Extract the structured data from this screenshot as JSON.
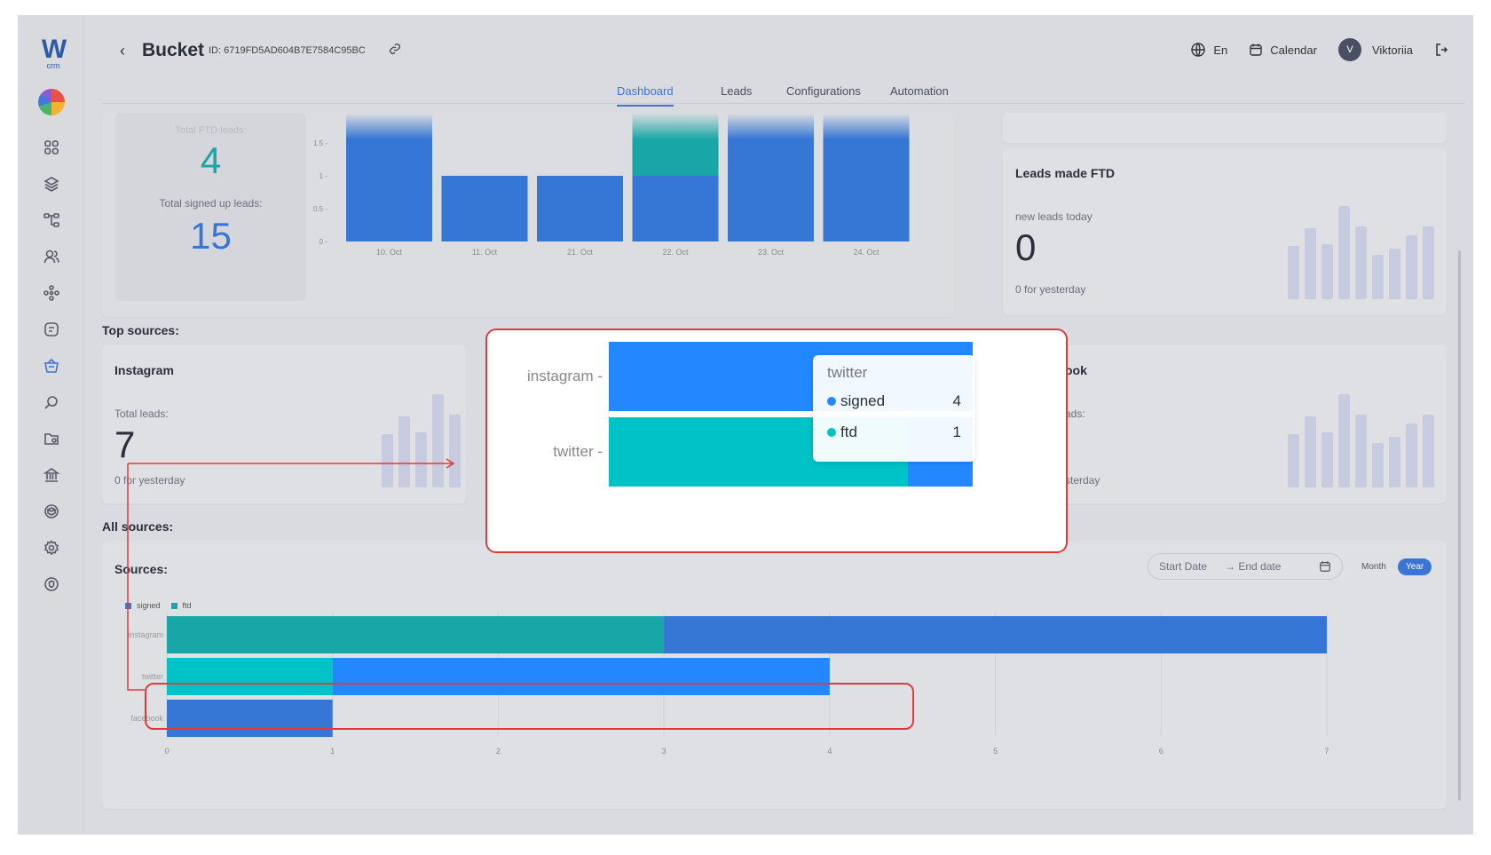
{
  "app": {
    "logo_letter": "W",
    "logo_sub": "crm"
  },
  "header": {
    "back_icon": "chevron-left-icon",
    "title": "Bucket",
    "bucket_id": "ID: 6719FD5AD604B7E7584C95BC",
    "language": "En",
    "calendar": "Calendar",
    "avatar_initial": "V",
    "user_name": "Viktoriia"
  },
  "tabs": [
    {
      "label": "Dashboard",
      "active": true
    },
    {
      "label": "Leads",
      "active": false
    },
    {
      "label": "Configurations",
      "active": false
    },
    {
      "label": "Automation",
      "active": false
    }
  ],
  "ftd_card": {
    "faded_label": "Total FTD leads:",
    "ftd_value": "4",
    "signed_label": "Total signed up leads:",
    "signed_value": "15"
  },
  "daily_chart": {
    "y_ticks": [
      "1.5",
      "1",
      "0.5",
      "0"
    ],
    "x_labels": [
      "10. Oct",
      "11. Oct",
      "21. Oct",
      "22. Oct",
      "23. Oct",
      "24. Oct"
    ]
  },
  "leads_made_ftd": {
    "title": "Leads made FTD",
    "sub_label": "new leads today",
    "value": "0",
    "footer": "0 for yesterday"
  },
  "top_sources": {
    "title": "Top sources:",
    "instagram": {
      "title": "Instagram",
      "label": "Total leads:",
      "value": "7",
      "footer": "0 for yesterday"
    },
    "facebook_partial": {
      "title": "ook",
      "label": "ads:",
      "footer": "sterday"
    }
  },
  "all_sources": {
    "title": "All sources:",
    "card_title": "Sources:",
    "start_date_placeholder": "Start Date",
    "end_date_placeholder": "→ End date",
    "month_label": "Month",
    "year_label": "Year",
    "legend_signed": "signed",
    "legend_ftd": "ftd"
  },
  "colors": {
    "signed": "#3676d4",
    "ftd": "#18a6a6",
    "signed_bright": "#2388ff",
    "ftd_bright": "#00c2c7",
    "accent": "#3b74d6"
  },
  "chart_data": [
    {
      "type": "bar",
      "orientation": "horizontal",
      "stacked": true,
      "title": "Sources:",
      "categories": [
        "instagram",
        "twitter",
        "facebook"
      ],
      "series": [
        {
          "name": "ftd",
          "values": [
            3,
            1,
            0
          ]
        },
        {
          "name": "signed",
          "values": [
            4,
            3,
            1
          ]
        }
      ],
      "x_ticks": [
        "0",
        "1",
        "2",
        "3",
        "4",
        "5",
        "6",
        "7"
      ],
      "xlim": [
        0,
        7
      ],
      "legend": "top-left"
    },
    {
      "type": "bar",
      "stacked": true,
      "categories": [
        "10. Oct",
        "11. Oct",
        "21. Oct",
        "22. Oct",
        "23. Oct",
        "24. Oct"
      ],
      "series": [
        {
          "name": "signed",
          "values": [
            2,
            1,
            1,
            1,
            2,
            2
          ]
        },
        {
          "name": "ftd",
          "values": [
            0,
            0,
            0,
            1,
            0,
            0
          ]
        }
      ],
      "y_ticks": [
        "0",
        "0.5",
        "1",
        "1.5"
      ]
    }
  ],
  "zoom_popup": {
    "categories": [
      "instagram",
      "twitter"
    ],
    "tooltip": {
      "title": "twitter",
      "rows": [
        {
          "name": "signed",
          "value": "4"
        },
        {
          "name": "ftd",
          "value": "1"
        }
      ]
    }
  }
}
